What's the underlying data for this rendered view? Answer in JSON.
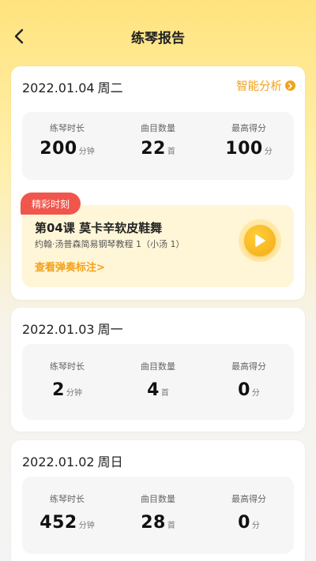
{
  "header": {
    "title": "练琴报告"
  },
  "reports": [
    {
      "date": "2022.01.04",
      "weekday": "周二",
      "smart_link": "智能分析",
      "stats": [
        {
          "label": "练琴时长",
          "value": "200",
          "unit": "分钟"
        },
        {
          "label": "曲目数量",
          "value": "22",
          "unit": "首"
        },
        {
          "label": "最高得分",
          "value": "100",
          "unit": "分"
        }
      ],
      "highlight": {
        "badge": "精彩时刻",
        "title": "第04课 莫卡辛软皮鞋舞",
        "subtitle": "约翰·汤普森简易钢琴教程 1（小汤 1）",
        "link": "查看弹奏标注>"
      }
    },
    {
      "date": "2022.01.03",
      "weekday": "周一",
      "stats": [
        {
          "label": "练琴时长",
          "value": "2",
          "unit": "分钟"
        },
        {
          "label": "曲目数量",
          "value": "4",
          "unit": "首"
        },
        {
          "label": "最高得分",
          "value": "0",
          "unit": "分"
        }
      ]
    },
    {
      "date": "2022.01.02",
      "weekday": "周日",
      "stats": [
        {
          "label": "练琴时长",
          "value": "452",
          "unit": "分钟"
        },
        {
          "label": "曲目数量",
          "value": "28",
          "unit": "首"
        },
        {
          "label": "最高得分",
          "value": "0",
          "unit": "分"
        }
      ]
    }
  ],
  "colors": {
    "accent": "#F3A11B",
    "badge": "#F0564C",
    "header_bg": "#FFE37E"
  }
}
